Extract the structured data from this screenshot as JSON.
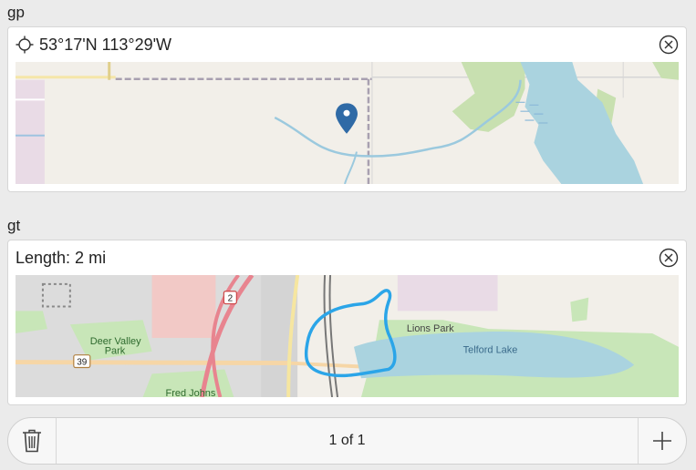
{
  "point_field": {
    "label": "gp",
    "value": "53°17'N 113°29'W"
  },
  "track_field": {
    "label": "gt",
    "value": "Length: 2 mi"
  },
  "track_map": {
    "place_deer_valley": "Deer Valley",
    "place_park": "Park",
    "place_lions_park": "Lions Park",
    "place_telford_lake": "Telford Lake",
    "place_fred_johns": "Fred Johns",
    "route_2": "2",
    "route_39": "39"
  },
  "pager": {
    "text": "1 of 1"
  },
  "colors": {
    "accent": "#2f6aa6",
    "track": "#2ba5e8",
    "water": "#aad3df"
  }
}
